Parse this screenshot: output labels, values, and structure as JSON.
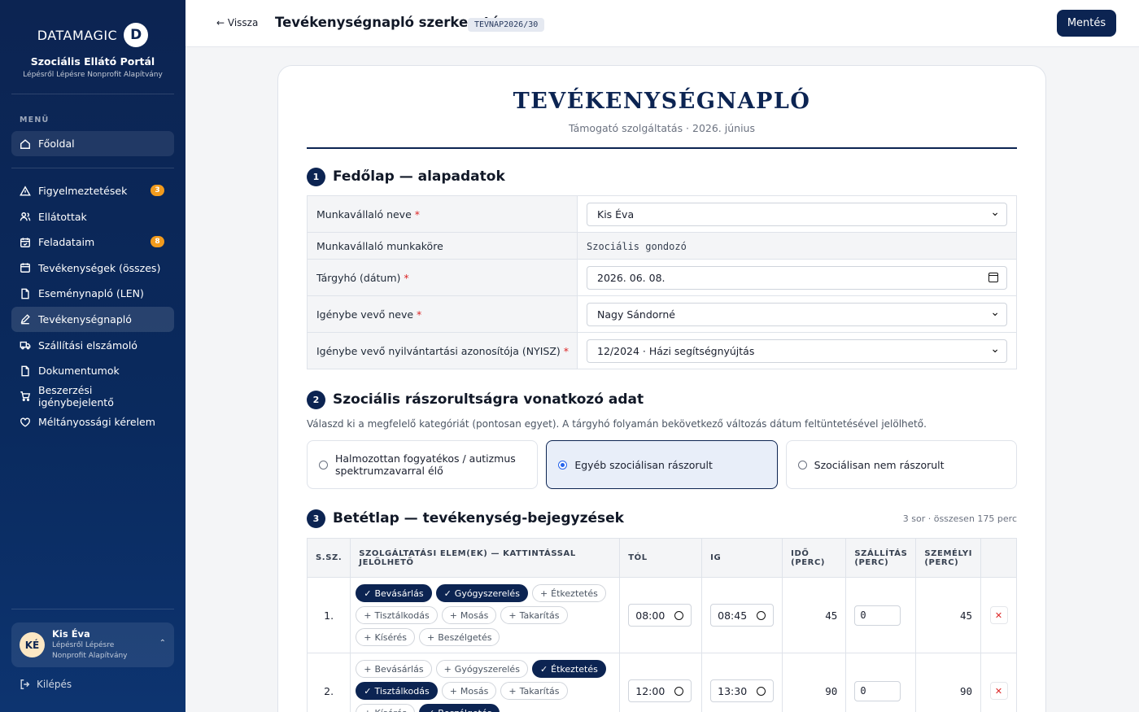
{
  "sidebar": {
    "brand_word": "DATAMAGIC",
    "brand_mark": "D",
    "portal_name": "Szociális Ellátó Portál",
    "portal_org": "Lépésről Lépésre Nonprofit Alapítvány",
    "menu_label": "MENÜ",
    "home": "Főoldal",
    "items": [
      {
        "label": "Figyelmeztetések",
        "icon": "warning-icon",
        "badge": "3"
      },
      {
        "label": "Ellátottak",
        "icon": "users-icon"
      },
      {
        "label": "Feladataim",
        "icon": "calendar-check-icon",
        "badge": "8"
      },
      {
        "label": "Tevékenységek (összes)",
        "icon": "calendar-icon"
      },
      {
        "label": "Eseménynapló (LEN)",
        "icon": "file-icon"
      },
      {
        "label": "Tevékenységnapló",
        "icon": "pencil-icon",
        "active": true
      },
      {
        "label": "Szállítási elszámoló",
        "icon": "truck-icon"
      },
      {
        "label": "Dokumentumok",
        "icon": "file-icon"
      },
      {
        "label": "Beszerzési igénybejelentő",
        "icon": "cart-icon"
      },
      {
        "label": "Méltányossági kérelem",
        "icon": "heart-icon"
      }
    ],
    "user": {
      "initials": "KÉ",
      "name": "Kis Éva",
      "org": "Lépésről Lépésre Nonprofit Alapítvány"
    },
    "logout": "Kilépés"
  },
  "topbar": {
    "back": "← Vissza",
    "title": "Tevékenységnapló szerkesztése",
    "doc_id": "TEVNAP2026/30",
    "save": "Mentés"
  },
  "document": {
    "title": "TEVÉKENYSÉGNAPLÓ",
    "subtitle": "Támogató szolgáltatás · 2026. június",
    "sec1": {
      "num": "1",
      "title": "Fedőlap — alapadatok",
      "rows": [
        {
          "label": "Munkavállaló neve",
          "required": true,
          "value": "Kis Éva",
          "kind": "select"
        },
        {
          "label": "Munkavállaló munkaköre",
          "required": false,
          "value": "Szociális gondozó",
          "kind": "readonly"
        },
        {
          "label": "Tárgyhó (dátum)",
          "required": true,
          "value": "2026. 06. 08.",
          "kind": "date"
        },
        {
          "label": "Igénybe vevő neve",
          "required": true,
          "value": "Nagy Sándorné",
          "kind": "select"
        },
        {
          "label": "Igénybe vevő nyilvántartási azonosítója (NYISZ)",
          "required": true,
          "value": "12/2024 · Házi segítségnyújtás",
          "kind": "select"
        }
      ]
    },
    "sec2": {
      "num": "2",
      "title": "Szociális rászorultságra vonatkozó adat",
      "hint": "Válaszd ki a megfelelő kategóriát (pontosan egyet). A tárgyhó folyamán bekövetkező változás dátum feltüntetésével jelölhető.",
      "options": [
        {
          "label": "Halmozottan fogyatékos / autizmus spektrumzavarral élő",
          "selected": false
        },
        {
          "label": "Egyéb szociálisan rászorult",
          "selected": true
        },
        {
          "label": "Szociálisan nem rászorult",
          "selected": false
        }
      ]
    },
    "sec3": {
      "num": "3",
      "title": "Betétlap — tevékenység-bejegyzések",
      "meta": "3 sor · összesen 175 perc",
      "headers": [
        "S.SZ.",
        "SZOLGÁLTATÁSI ELEM(EK) — KATTINTÁSSAL JELÖLHETŐ",
        "TÓL",
        "IG",
        "IDŐ (PERC)",
        "SZÁLLÍTÁS (PERC)",
        "SZEMÉLYI (PERC)",
        ""
      ],
      "rows": [
        {
          "index": "1.",
          "chips": [
            {
              "label": "Bevásárlás",
              "on": true
            },
            {
              "label": "Gyógyszerelés",
              "on": true
            },
            {
              "label": "Étkeztetés",
              "on": false
            },
            {
              "label": "Tisztálkodás",
              "on": false
            },
            {
              "label": "Mosás",
              "on": false
            },
            {
              "label": "Takarítás",
              "on": false
            },
            {
              "label": "Kísérés",
              "on": false
            },
            {
              "label": "Beszélgetés",
              "on": false
            }
          ],
          "from": "08:00",
          "to": "08:45",
          "time": "45",
          "transport": "0",
          "personal": "45"
        },
        {
          "index": "2.",
          "chips": [
            {
              "label": "Bevásárlás",
              "on": false
            },
            {
              "label": "Gyógyszerelés",
              "on": false
            },
            {
              "label": "Étkeztetés",
              "on": true
            },
            {
              "label": "Tisztálkodás",
              "on": true
            },
            {
              "label": "Mosás",
              "on": false
            },
            {
              "label": "Takarítás",
              "on": false
            },
            {
              "label": "Kísérés",
              "on": false
            },
            {
              "label": "Beszélgetés",
              "on": true
            }
          ],
          "from": "12:00",
          "to": "13:30",
          "time": "90",
          "transport": "0",
          "personal": "90"
        }
      ]
    }
  },
  "colors": {
    "navy": "#0c2452",
    "accent_badge": "#f29b1d",
    "required": "#dc2626"
  }
}
